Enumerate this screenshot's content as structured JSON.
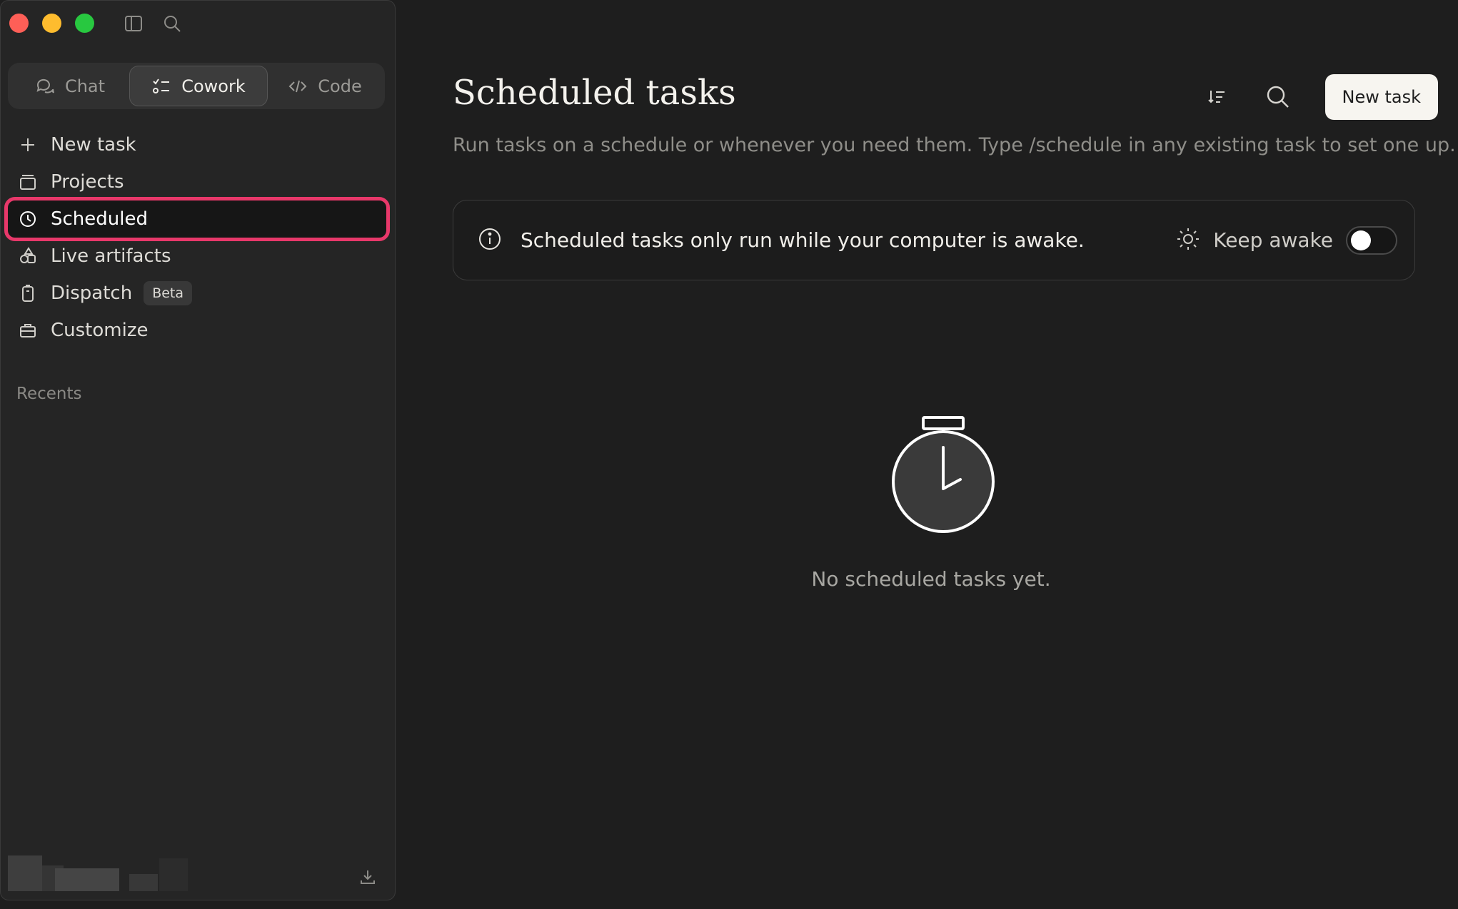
{
  "sidebar": {
    "modes": [
      {
        "label": "Chat",
        "icon": "chat-bubbles-icon"
      },
      {
        "label": "Cowork",
        "icon": "checklist-icon",
        "selected": true
      },
      {
        "label": "Code",
        "icon": "code-icon"
      }
    ],
    "nav": [
      {
        "label": "New task",
        "icon": "plus-icon"
      },
      {
        "label": "Projects",
        "icon": "folder-stack-icon"
      },
      {
        "label": "Scheduled",
        "icon": "clock-icon",
        "active": true
      },
      {
        "label": "Live artifacts",
        "icon": "shapes-icon"
      },
      {
        "label": "Dispatch",
        "icon": "phone-icon",
        "badge": "Beta"
      },
      {
        "label": "Customize",
        "icon": "briefcase-icon"
      }
    ],
    "recents_label": "Recents"
  },
  "main": {
    "title": "Scheduled tasks",
    "subtitle": "Run tasks on a schedule or whenever you need them. Type /schedule in any existing task to set one up.",
    "new_task_label": "New task",
    "banner": {
      "text": "Scheduled tasks only run while your computer is awake.",
      "keep_awake_label": "Keep awake",
      "keep_awake_on": false
    },
    "empty_text": "No scheduled tasks yet."
  },
  "colors": {
    "highlight": "#e8386a",
    "background": "#1e1e1e",
    "sidebar": "#252525"
  }
}
